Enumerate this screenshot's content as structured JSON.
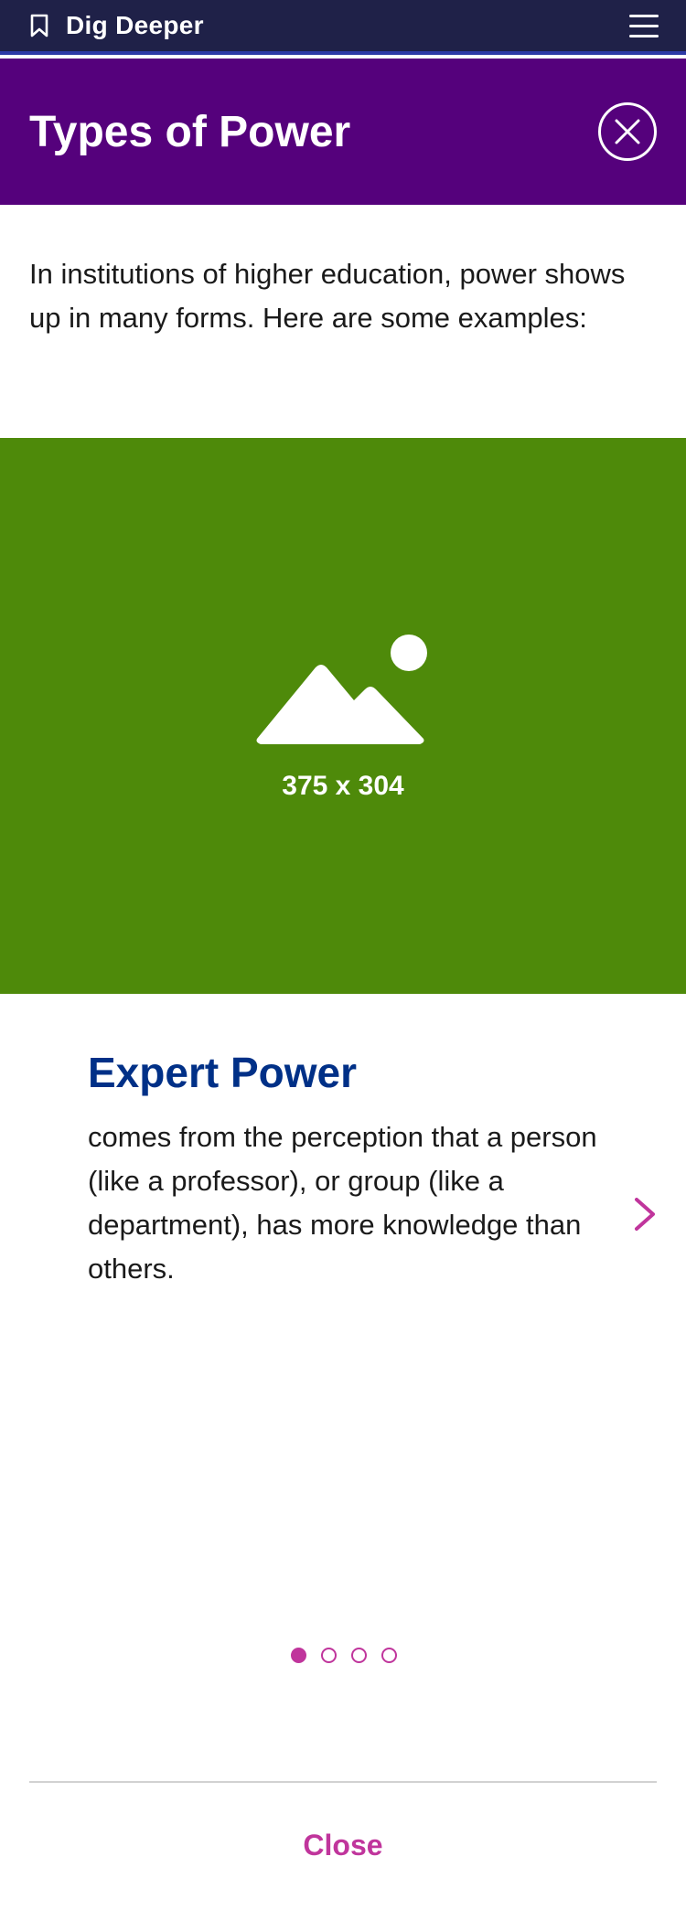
{
  "topbar": {
    "title": "Dig Deeper",
    "bookmark_icon": "bookmark-icon",
    "menu_icon": "hamburger-menu-icon"
  },
  "modal": {
    "title": "Types of Power",
    "close_icon": "close-icon"
  },
  "intro": {
    "text": "In institutions of higher education, power shows up in many forms. Here are some examples:"
  },
  "image_placeholder": {
    "icon": "image-icon",
    "dimensions": "375 x 304",
    "background": "#4e8a0a"
  },
  "card": {
    "title": "Expert Power",
    "body": "comes from the perception that a person (like a professor), or group (like a department), has more knowledge than others.",
    "next_icon": "chevron-right-icon"
  },
  "pagination": {
    "total": 4,
    "active_index": 0
  },
  "footer": {
    "close_label": "Close"
  },
  "colors": {
    "topbar": "#1f2148",
    "header": "#55017c",
    "title_blue": "#003087",
    "accent_magenta": "#c0359c"
  }
}
